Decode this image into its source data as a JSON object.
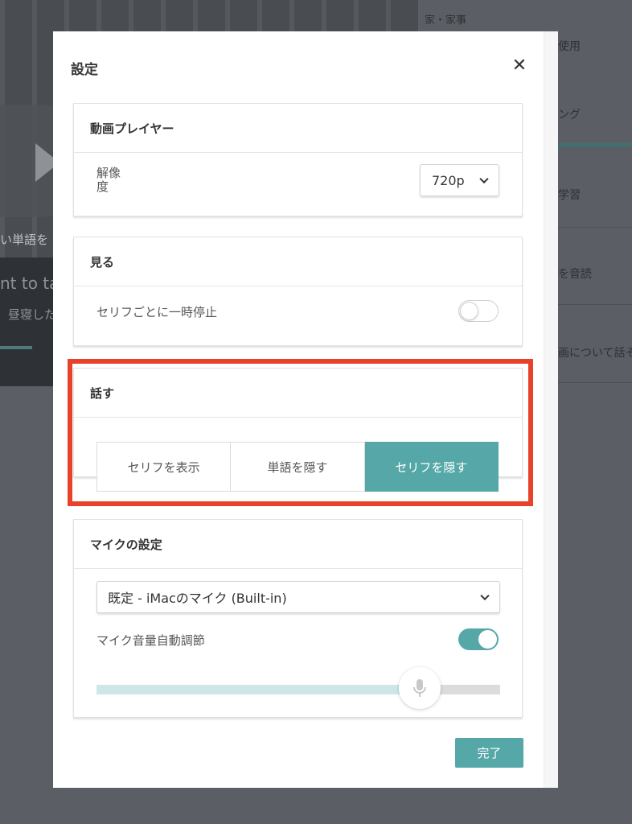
{
  "background": {
    "category": "家・家事",
    "video_overlay_text": "い単語を",
    "caption_text": "nt to ta",
    "caption_subtext": "昼寝した",
    "right_items": [
      "使用",
      "ング",
      "学習",
      "を音読",
      "画について話そ"
    ]
  },
  "modal": {
    "title": "設定",
    "close_symbol": "✕"
  },
  "video_player": {
    "title": "動画プレイヤー",
    "resolution_label": "解像\n度",
    "resolution_value": "720p"
  },
  "view": {
    "title": "見る",
    "pause_label": "セリフごとに一時停止",
    "pause_enabled": false
  },
  "speak": {
    "title": "話す",
    "options": [
      "セリフを表示",
      "単語を隠す",
      "セリフを隠す"
    ],
    "selected_index": 2
  },
  "mic": {
    "title": "マイクの設定",
    "device_value": "既定 - iMacのマイク (Built-in)",
    "auto_gain_label": "マイク音量自動調節",
    "auto_gain_enabled": true,
    "volume_fraction": 0.79
  },
  "footer": {
    "done_label": "完了"
  },
  "colors": {
    "accent": "#56a8a8",
    "highlight": "#e8432a"
  }
}
